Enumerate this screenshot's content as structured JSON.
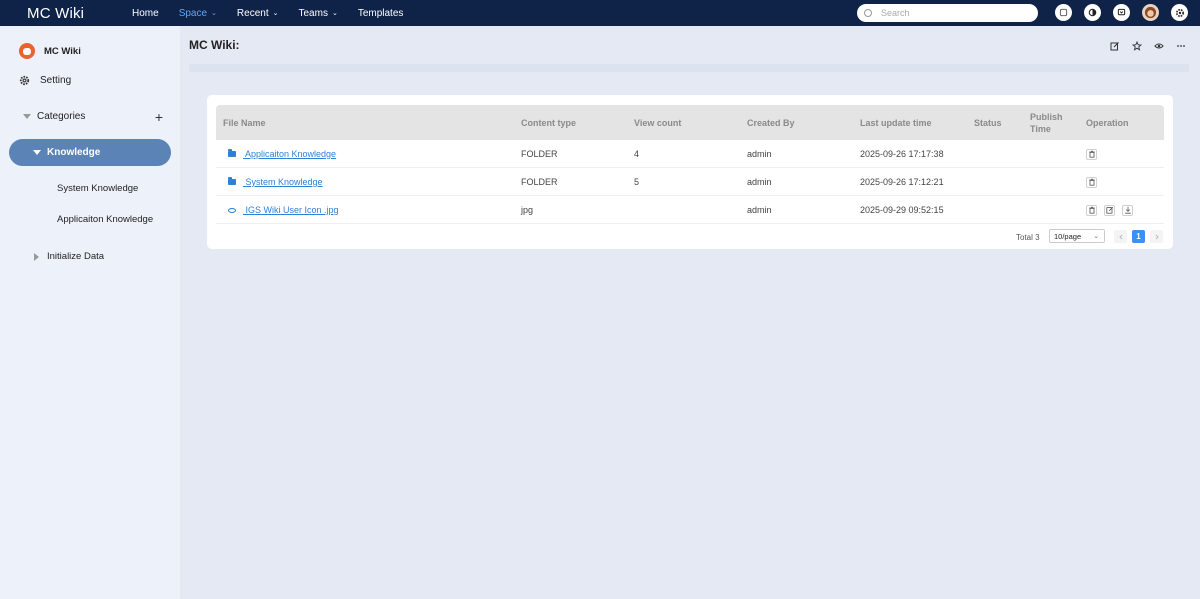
{
  "app": {
    "brand": "MC Wiki"
  },
  "nav": {
    "items": [
      {
        "label": "Home",
        "has_menu": false,
        "active": false
      },
      {
        "label": "Space",
        "has_menu": true,
        "active": true
      },
      {
        "label": "Recent",
        "has_menu": true,
        "active": false
      },
      {
        "label": "Teams",
        "has_menu": true,
        "active": false
      },
      {
        "label": "Templates",
        "has_menu": false,
        "active": false
      }
    ],
    "chevron": "⌄"
  },
  "search": {
    "placeholder": "Search"
  },
  "topbar_icons": [
    "help-icon",
    "theme-icon",
    "notification-icon",
    "avatar",
    "settings-icon"
  ],
  "sidebar": {
    "space_name": "MC Wiki",
    "setting_label": "Setting",
    "categories_label": "Categories",
    "add_symbol": "+",
    "active_category": "Knowledge",
    "children": [
      "System Knowledge",
      "Applicaiton Knowledge"
    ],
    "collapsed_category": "Initialize Data"
  },
  "main": {
    "title": "MC Wiki:",
    "table": {
      "headers": {
        "file_name": "File Name",
        "content_type": "Content type",
        "view_count": "View count",
        "created_by": "Created By",
        "last_update": "Last update time",
        "status": "Status",
        "publish_time": "Publish Time",
        "operation": "Operation"
      },
      "rows": [
        {
          "icon": "folder-icon",
          "name": " Applicaiton Knowledge",
          "content_type": "FOLDER",
          "view_count": "4",
          "created_by": "admin",
          "last_update": "2025-09-26 17:17:38",
          "status": "",
          "publish_time": "",
          "ops": [
            "delete-icon"
          ]
        },
        {
          "icon": "folder-icon",
          "name": " System Knowledge",
          "content_type": "FOLDER",
          "view_count": "5",
          "created_by": "admin",
          "last_update": "2025-09-26 17:12:21",
          "status": "",
          "publish_time": "",
          "ops": [
            "delete-icon"
          ]
        },
        {
          "icon": "eye-icon",
          "name": " IGS Wiki User Icon .jpg",
          "content_type": "jpg",
          "view_count": "",
          "created_by": "admin",
          "last_update": "2025-09-29 09:52:15",
          "status": "",
          "publish_time": "",
          "ops": [
            "delete-icon",
            "edit-icon",
            "download-icon"
          ]
        }
      ]
    },
    "pagination": {
      "total_text": "Total 3",
      "page_size": "10/page",
      "current_page": "1"
    }
  }
}
